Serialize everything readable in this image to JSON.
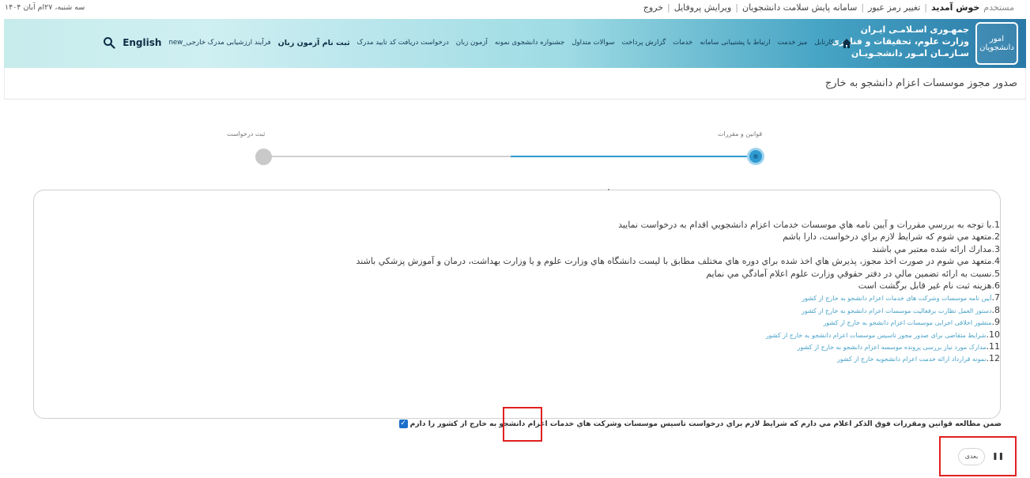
{
  "topbar": {
    "date": "سه شنبه، ۲۷ام آبان ۱۴۰۴",
    "user_label": "خوش آمدید",
    "user_name": "مستخدم",
    "links": [
      "تغییر رمز عبور",
      "سامانه پایش سلامت دانشجویان",
      "ویرایش پروفایل",
      "خروج"
    ]
  },
  "header": {
    "emblem_text": "امور دانشجویان",
    "logo_lines": [
      "جمهـوری اسـلامـی ایـران",
      "وزارت علوم، تحقیقات و فناوری",
      "سـازمـان امـور دانشجـویـان"
    ],
    "nav": [
      "کارتابل",
      "میز خدمت",
      "ارتباط با پشتیبانی سامانه",
      "خدمات",
      "گزارش پرداخت",
      "سوالات متداول",
      "جشنواره دانشجوی نمونه",
      "آزمون زبان",
      "درخواست دریافت کد تایید مدرک",
      "ثبت نام آزمون زبان",
      "فرآیند ارزشیابی مدرک خارجی_new"
    ],
    "english": "English"
  },
  "page": {
    "title": "صدور مجوز موسسات اعزام دانشجو به خارج"
  },
  "stepper": {
    "step1_label": "قوانین و مقررات",
    "step2_label": "ثبت درخواست",
    "active_step": 1,
    "progress_fraction": 0.5
  },
  "rules": {
    "items": [
      {
        "num": "1.",
        "text": "با توجه به بررسي مقررات و آيين نامه هاي موسسات خدمات اعزام دانشجويي اقدام به درخواست نماييد",
        "link": false
      },
      {
        "num": "2.",
        "text": "متعهد مي شوم كه شرايط لازم براي درخواست، دارا باشم",
        "link": false
      },
      {
        "num": "3.",
        "text": "مدارك ارائه شده معتبر مي باشند",
        "link": false
      },
      {
        "num": "4.",
        "text": "متعهد مي شوم در صورت اخذ مجوز، پذيرش هاي اخذ شده براي دوره هاي مختلف مطابق با ليست دانشگاه هاي وزارت علوم و يا وزارت بهداشت، درمان و آموزش پزشكي باشند",
        "link": false
      },
      {
        "num": "5.",
        "text": "نسبت به ارائه تضمين مالي در دفتر حقوقي وزارت علوم اعلام آمادگي مي نمايم",
        "link": false
      },
      {
        "num": "6.",
        "text": "هزينه ثبت نام غير قابل برگشت است",
        "link": false
      },
      {
        "num": "7.",
        "text": "آیین نامه موسسات وشرکت های خدمات اعزام دانشجو به خارج از کشور",
        "link": true
      },
      {
        "num": "8.",
        "text": "دستور العمل نظارت برفعالیت موسسات اعزام دانشجو به خارج از کشور",
        "link": true
      },
      {
        "num": "9.",
        "text": "منشور اخلاقی اجرایی موسسات اعزام دانشجو به خارج از کشور",
        "link": true
      },
      {
        "num": "10.",
        "text": "شرایط متقاضی برای صدور مجوز تاسیس موسسات اعزام دانشجو به خارج از کشور",
        "link": true
      },
      {
        "num": "11.",
        "text": "مدارک مورد نیاز بررسی پرونده موسسه اعزام دانشجو به خارج از کشور",
        "link": true
      },
      {
        "num": "12.",
        "text": "نمونه قرارداد ارائه خدمت اعزام دانشجویه خارج از کشور",
        "link": true
      }
    ]
  },
  "agreement": {
    "text": "ضمن مطالعه قوانين ومقررات فوق الذكر اعلام مي دارم كه شرايط لازم براي درخواست تاسيس موسسات وشركت هاي خدمات اعزام دانشجو به خارج از كشور را دارم",
    "checked": true,
    "check_glyph": "✓"
  },
  "buttons": {
    "next": "بعدی",
    "pause_glyph": "❚❚"
  },
  "colors": {
    "accent": "#2f9ad0",
    "highlight": "#e02020",
    "link": "#4aa3c8"
  }
}
